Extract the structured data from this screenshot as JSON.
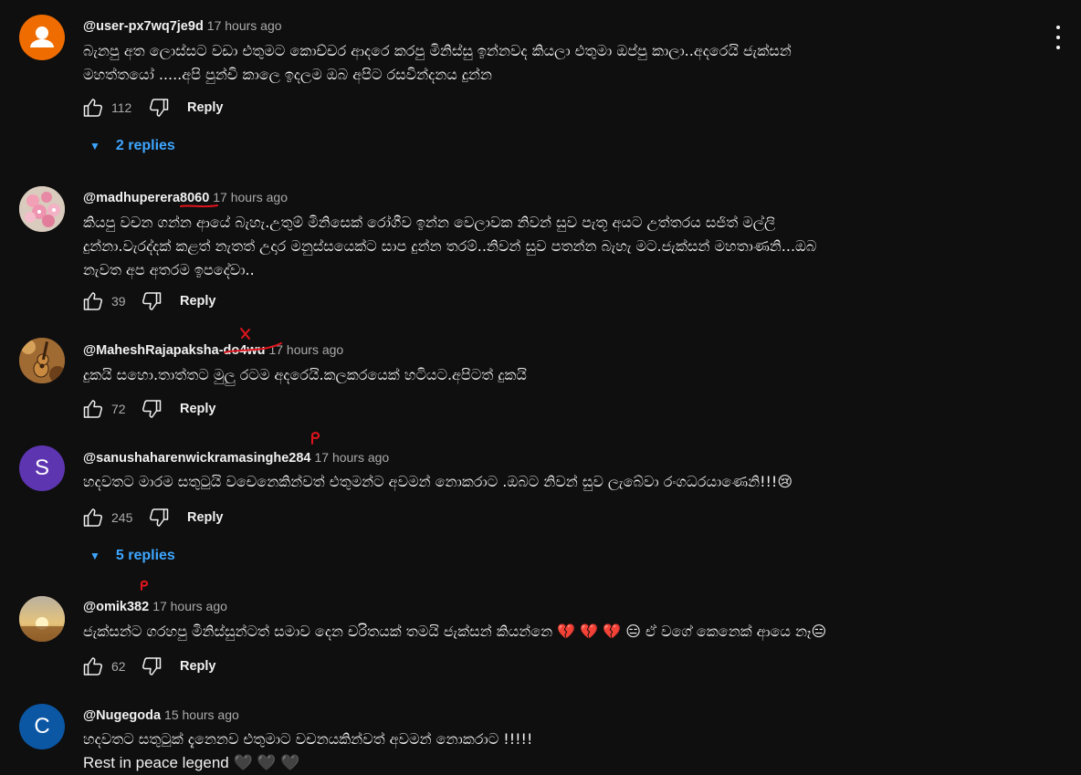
{
  "actions": {
    "reply_label": "Reply"
  },
  "comments": [
    {
      "handle": "@user-px7wq7je9d",
      "time": "17 hours ago",
      "line1": "බැනපු අත ලොස්සට වඩා එතුමට කොච්චර ආදරෙ කරපු මිනිස්සු ඉන්නවද කියලා එතුමා ඔප්පු කාලා..අදරෙයි ජැක්සන්",
      "line2": "මහත්තයෝ .....අපි පුන්චි කාලෙ ඉදලම ඔබ අපිට රසවින්දනය දුන්න",
      "likes": "112",
      "replies": "2 replies"
    },
    {
      "handle": "@madhuperera8060",
      "time": "17 hours ago",
      "line1": "කියපු වචන ගන්න ආයේ බැහැ.උතුම් මිනිසෙක් රෝගීව ඉන්න වෙලාවක නිවන් සුව පැතූ අයට උත්තරය සජිත් මල්ලි",
      "line2": "දුන්නා.වැරද්දක් කළත් නැතත් උදාර මනුස්සයෙක්ට සාප දුන්න තරම්..නිවන් සුව පතන්න බැහැ මට.ජැක්සන් මහතාණනි...ඔබ",
      "line3": "නැවත අප අතරම ඉපදේවා..",
      "likes": "39"
    },
    {
      "handle": "@MaheshRajapaksha-do4wu",
      "time": "17 hours ago",
      "line1": "දුකයි සහො.තාත්තට මුලු රටම අදරෙයි.කලකරයෙක් හටියට.අපිටත්  දුකයි",
      "likes": "72"
    },
    {
      "handle": "@sanushaharenwickramasinghe284",
      "time": "17 hours ago",
      "line1": "හදවතට මාරම සතුටුයි වචෙනෙකින්වත් එතුමන්ට අවමන් නොකරාට .ඔබට නිවන් සුව ලැබේවා රංගධරයාණෙනි!!!😢",
      "avatar_letter": "S",
      "likes": "245",
      "replies": "5 replies"
    },
    {
      "handle": "@omik382",
      "time": "17 hours ago",
      "line1": "ජැක්සන්ට ගරහපු මිනිස්සුන්ටත් සමාව දෙන චරිතයක් තමයි ජැක්සන් කියන්නෙ 💔 💔 💔 😑  ඒ වගේ කෙනෙක් ආයෙ නෑ😑",
      "likes": "62"
    },
    {
      "handle": "@Nugegoda",
      "time": "15 hours ago",
      "line1": "හදවතට සතුටුක් දැනෙනව එතුමාට වචනයකින්වත්  අවමන් නොකරාට !!!!!",
      "line2": "Rest in peace legend  🖤 🖤 🖤",
      "avatar_letter": "C"
    }
  ],
  "colors": {
    "background": "#0f0f0f",
    "link_blue": "#3ea6ff",
    "secondary_text": "#aaaaaa",
    "avatar_orange": "#ef6c00",
    "avatar_purple": "#5e35b1",
    "avatar_blue": "#0b57a4",
    "annotation_red": "#e0141c"
  }
}
